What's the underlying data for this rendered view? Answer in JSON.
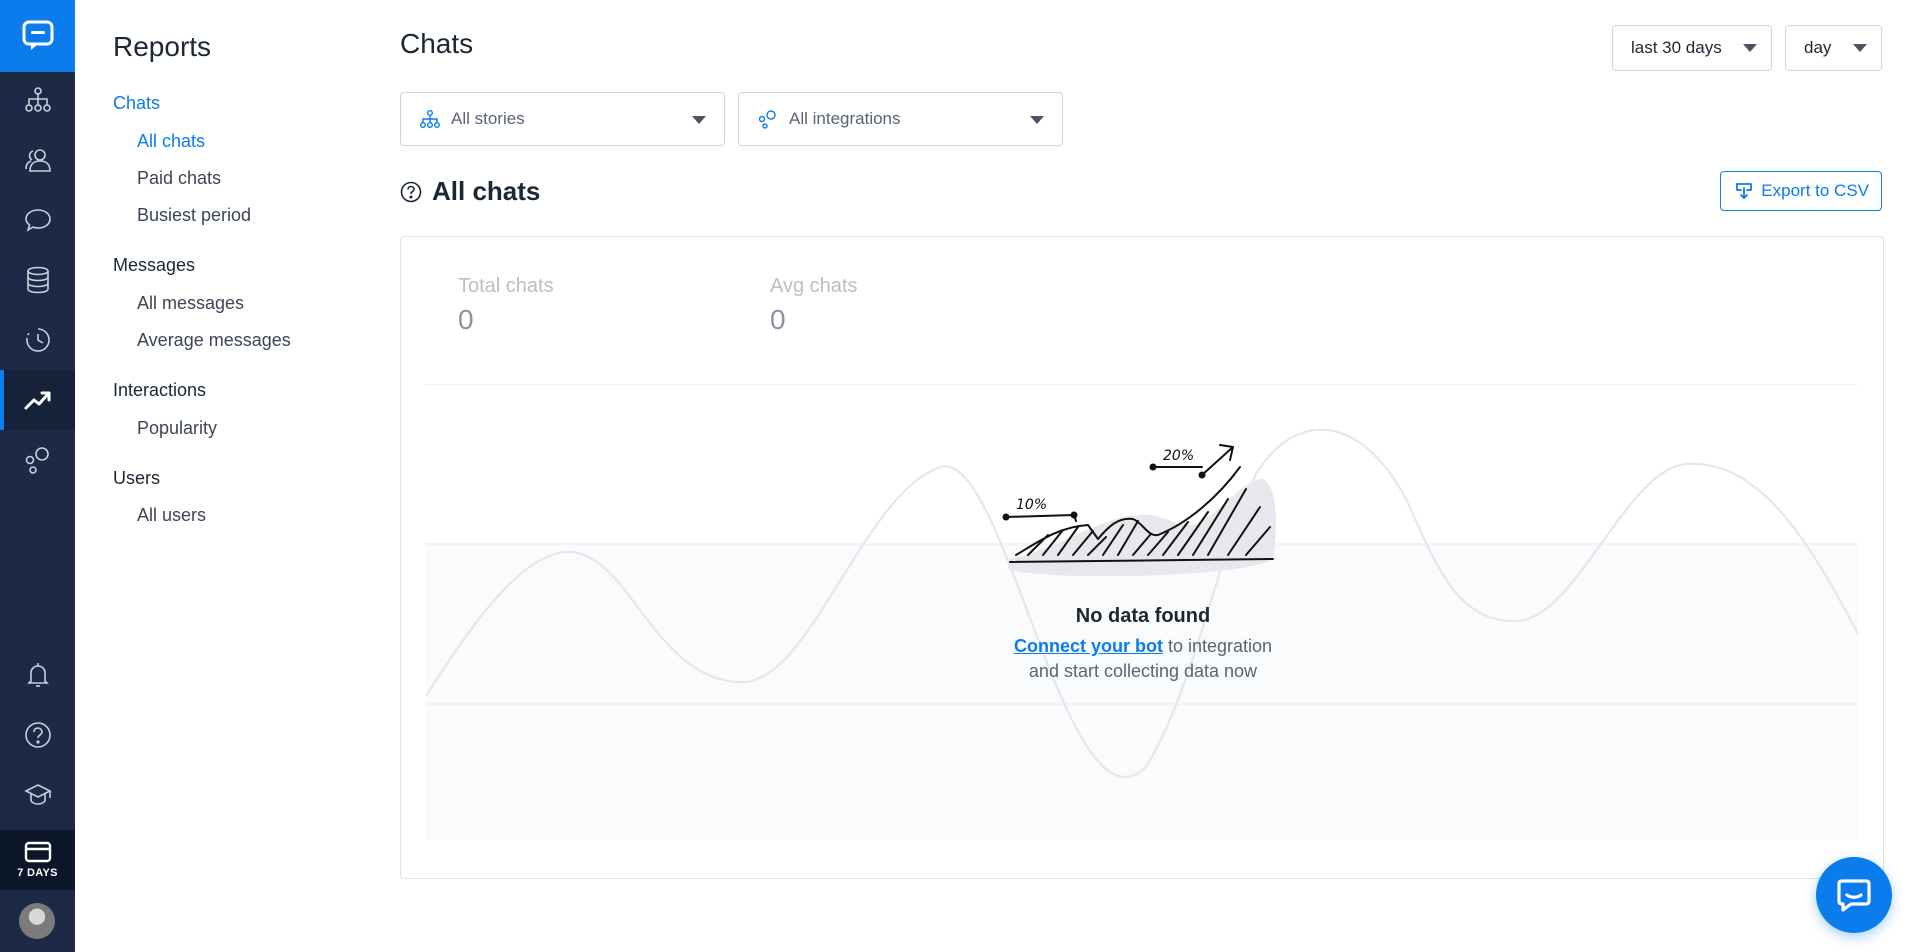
{
  "rail": {
    "items": [
      {
        "name": "integrations-icon"
      },
      {
        "name": "users-icon"
      },
      {
        "name": "chats-icon"
      },
      {
        "name": "database-icon"
      },
      {
        "name": "history-icon"
      },
      {
        "name": "reports-icon",
        "active": true
      },
      {
        "name": "stories-icon"
      }
    ],
    "trial_label": "7 DAYS"
  },
  "subnav": {
    "title": "Reports",
    "groups": [
      {
        "label": "Chats",
        "active": true,
        "links": [
          {
            "label": "All chats",
            "active": true
          },
          {
            "label": "Paid chats"
          },
          {
            "label": "Busiest period"
          }
        ]
      },
      {
        "label": "Messages",
        "links": [
          {
            "label": "All messages"
          },
          {
            "label": "Average messages"
          }
        ]
      },
      {
        "label": "Interactions",
        "links": [
          {
            "label": "Popularity"
          }
        ]
      },
      {
        "label": "Users",
        "links": [
          {
            "label": "All users"
          }
        ]
      }
    ]
  },
  "main": {
    "title": "Chats",
    "range_select": "last 30 days",
    "interval_select": "day",
    "filters": {
      "stories": "All stories",
      "integrations": "All integrations"
    },
    "section_title": "All chats",
    "export_label": "Export to CSV",
    "stats": [
      {
        "label": "Total chats",
        "value": "0"
      },
      {
        "label": "Avg chats",
        "value": "0"
      }
    ],
    "empty": {
      "title": "No data found",
      "link_text": "Connect your bot",
      "text_after_link": " to integration",
      "text_line2": "and start collecting data now",
      "illustration_labels": [
        "10%",
        "20%"
      ]
    }
  },
  "colors": {
    "accent": "#0a7cec",
    "rail_bg": "#1c2a46"
  }
}
